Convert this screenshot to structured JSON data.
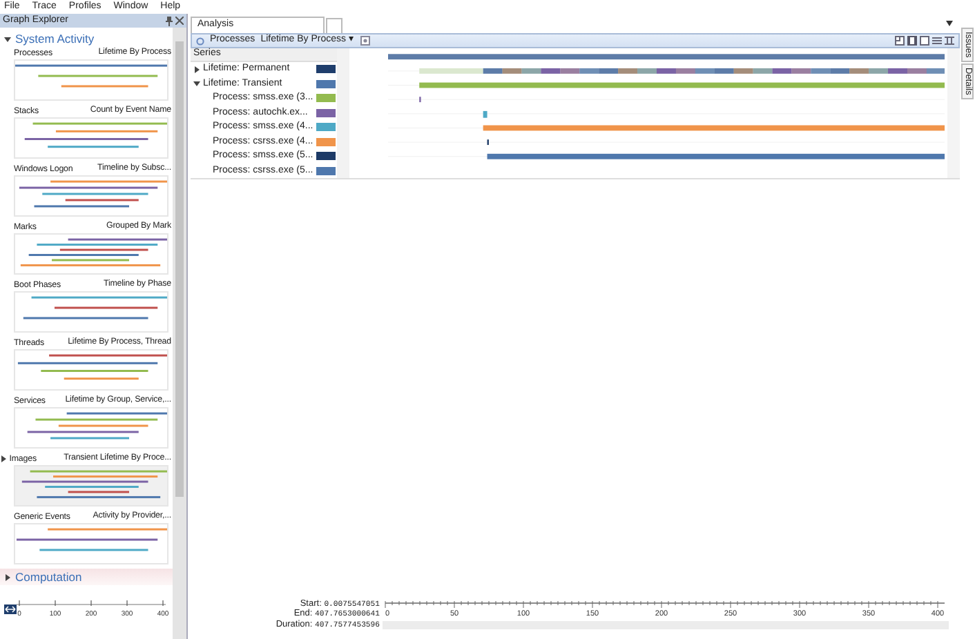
{
  "menu": [
    "File",
    "Trace",
    "Profiles",
    "Window",
    "Help"
  ],
  "graph_explorer": {
    "title": "Graph Explorer",
    "sections": [
      {
        "title": "System Activity",
        "expanded": true,
        "graphs": [
          {
            "name": "Processes",
            "preset": "Lifetime By Process",
            "kind": "graph"
          },
          {
            "name": "Stacks",
            "preset": "Count by Event Name",
            "kind": "graph"
          },
          {
            "name": "Windows Logon",
            "preset": "Timeline by Subsc...",
            "kind": "graph"
          },
          {
            "name": "Marks",
            "preset": "Grouped By Mark",
            "kind": "graph"
          },
          {
            "name": "Boot Phases",
            "preset": "Timeline by Phase",
            "kind": "graph"
          },
          {
            "name": "Threads",
            "preset": "Lifetime By Process, Thread",
            "kind": "graph"
          },
          {
            "name": "Services",
            "preset": "Lifetime by Group, Service,...",
            "kind": "graph"
          },
          {
            "name": "Images",
            "preset": "Transient Lifetime By Proce...",
            "kind": "group"
          },
          {
            "name": "Generic Events",
            "preset": "Activity by Provider,...",
            "kind": "graph"
          }
        ]
      },
      {
        "title": "Computation",
        "expanded": false,
        "thumbnail_ticks": [
          "0",
          "100",
          "200",
          "300",
          "400"
        ]
      }
    ]
  },
  "tabs": [
    {
      "label": "Analysis",
      "selected": true
    }
  ],
  "graph": {
    "name": "Processes",
    "preset": "Lifetime By Process ▾",
    "series_header": "Series",
    "series": [
      {
        "label": "Lifetime: Permanent",
        "color": "#1f3e6c",
        "expanded": false
      },
      {
        "label": "Lifetime: Transient",
        "color": "#4f78ad",
        "expanded": true,
        "children": [
          {
            "label": "Process: smss.exe (3...",
            "color": "#93bb4f"
          },
          {
            "label": "Process: autochk.ex...",
            "color": "#7b63a5"
          },
          {
            "label": "Process: smss.exe (4...",
            "color": "#4ea9c6"
          },
          {
            "label": "Process: csrss.exe (4...",
            "color": "#f0944a"
          },
          {
            "label": "Process: smss.exe (5...",
            "color": "#1d3a66"
          },
          {
            "label": "Process: csrss.exe (5...",
            "color": "#4f78ad"
          }
        ]
      }
    ]
  },
  "side_tabs": [
    "Issues",
    "Details"
  ],
  "timeline": {
    "start_label": "Start:",
    "start": "0.0075547051",
    "end_label": "End:",
    "end": "407.7653000641",
    "duration_label": "Duration:",
    "duration": "407.7577453596",
    "ticks": [
      "0",
      "50",
      "100",
      "150",
      "200",
      "250",
      "300",
      "350",
      "400"
    ]
  }
}
